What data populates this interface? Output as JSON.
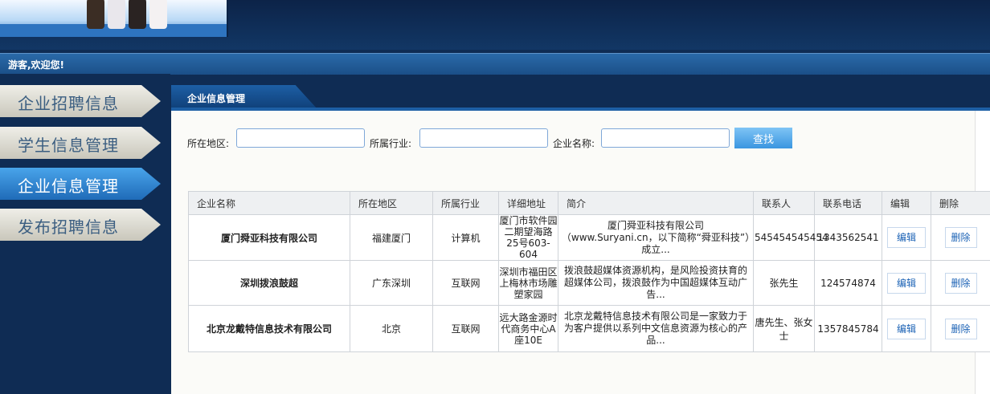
{
  "header": {
    "welcome": "游客,欢迎您!"
  },
  "sidebar": {
    "items": [
      {
        "label": "企业招聘信息",
        "active": false
      },
      {
        "label": "学生信息管理",
        "active": false
      },
      {
        "label": "企业信息管理",
        "active": true
      },
      {
        "label": "发布招聘信息",
        "active": false
      }
    ]
  },
  "panel": {
    "title": "企业信息管理"
  },
  "search": {
    "region_label": "所在地区:",
    "industry_label": "所属行业:",
    "company_label": "企业名称:",
    "button": "查找"
  },
  "table": {
    "headers": [
      "企业名称",
      "所在地区",
      "所属行业",
      "详细地址",
      "简介",
      "联系人",
      "联系电话",
      "编辑",
      "删除"
    ],
    "rows": [
      {
        "name": "厦门舜亚科技有限公司",
        "region": "福建厦门",
        "industry": "计算机",
        "address": "厦门市软件园二期望海路25号603-604",
        "intro": "厦门舜亚科技有限公司（www.Suryani.cn，以下简称“舜亚科技”）成立...",
        "contact": "545454545454",
        "phone": "1343562541",
        "edit": "编辑",
        "delete": "删除"
      },
      {
        "name": "深圳拨浪鼓超",
        "region": "广东深圳",
        "industry": "互联网",
        "address": "深圳市福田区上梅林市场雕塑家园",
        "intro": "拨浪鼓超媒体资源机构，是风险投资扶育的超媒体公司，拨浪鼓作为中国超媒体互动广告...",
        "contact": "张先生",
        "phone": "124574874",
        "edit": "编辑",
        "delete": "删除"
      },
      {
        "name": "北京龙戴特信息技术有限公司",
        "region": "北京",
        "industry": "互联网",
        "address": "远大路金源时代商务中心A座10E",
        "intro": "北京龙戴特信息技术有限公司是一家致力于为客户提供以系列中文信息资源为核心的产品...",
        "contact": "唐先生、张女士",
        "phone": "1357845784",
        "edit": "编辑",
        "delete": "删除"
      }
    ]
  },
  "colors": {
    "header_bg": "#0f2c54",
    "active_item": "#2f84d2",
    "company_link": "#1b4fa7",
    "tab_bg": "#1d5fa5"
  }
}
